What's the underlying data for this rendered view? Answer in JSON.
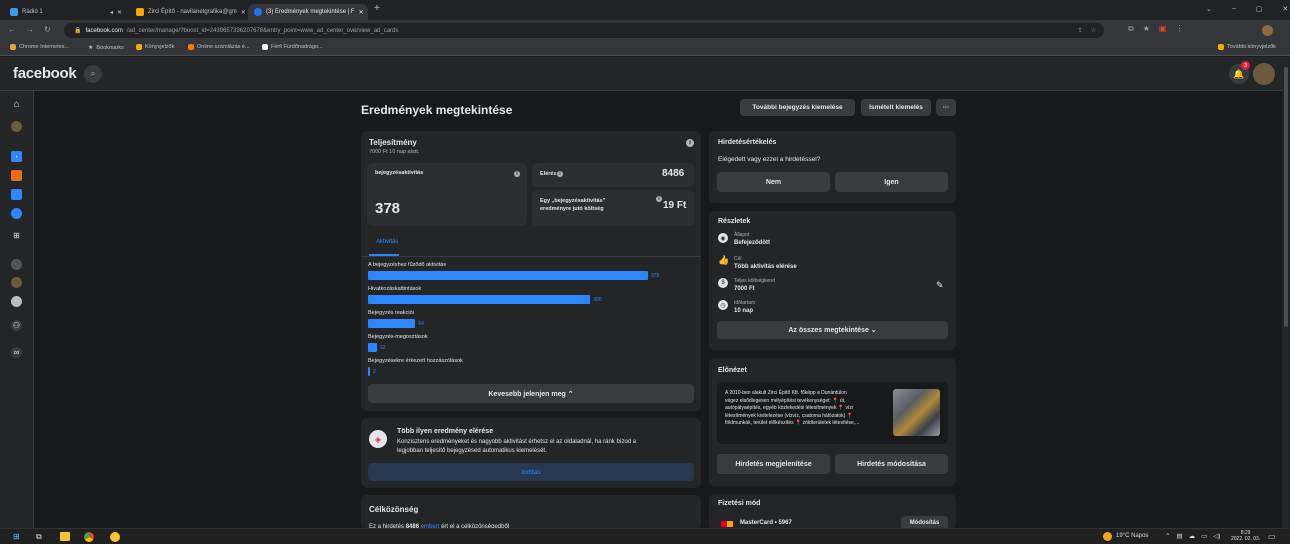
{
  "browser": {
    "tabs": [
      {
        "title": "Rádió 1",
        "color": "#3d9be9"
      },
      {
        "title": "Zirci Építő - navilanetgrafika@gm",
        "color": "#f9ab00"
      },
      {
        "title": "(3) Eredmények megtekintése | F",
        "color": "#1877f2"
      }
    ],
    "new_tab": "+",
    "window_controls": [
      "⌄",
      "–",
      "▢",
      "✕"
    ],
    "url_host": "facebook.com",
    "url_path": "/ad_center/manage/?boost_id=2439657336207678&entry_point=www_ad_center_overview_ad_cards",
    "bookmarks": [
      "Chrome Internetes...",
      "Bookmarks",
      "Könyvjelzők",
      "Online számlázás é...",
      "Férfi Fürdőnadrágo..."
    ],
    "other_bookmarks": "További könyvjelzők"
  },
  "fb": {
    "logo": "facebook",
    "notif_count": "3",
    "page_title": "Eredmények megtekintése",
    "actions": [
      "További bejegyzés kiemelése",
      "Ismételt kiemelés",
      "···"
    ]
  },
  "performance": {
    "title": "Teljesítmény",
    "subtitle": "7000 Ft 10 nap alatt.",
    "activity_label": "bejegyzésaktivitás",
    "activity_value": "378",
    "reach_label": "Elérés",
    "reach_value": "8486",
    "cost_label_1": "Egy „bejegyzésaktivitás\"",
    "cost_label_2": "eredményre jutó költség",
    "cost_value": "19 Ft",
    "tab": "Aktivitás"
  },
  "chart_data": {
    "type": "bar",
    "orientation": "horizontal",
    "categories": [
      "A bejegyzéshez fűződő aktivitás",
      "Hivatkozáskattintások",
      "Bejegyzés reakciói",
      "Bejegyzés-megosztások",
      "Bejegyzésekre érkezett hozzászólások"
    ],
    "values": [
      378,
      300,
      64,
      12,
      2
    ],
    "color": "#2d88ff"
  },
  "show_less": "Kevesebb jelenjen meg ⌃",
  "more_results": {
    "title": "Több ilyen eredmény elérése",
    "text_1": "Konzisztens eredményeket és nagyobb aktivitást érhetsz el az oldaladnál, ha ránk bízod a",
    "text_2": "legjobban teljesítő bejegyzésed automatikus kiemelését.",
    "button": "Indítás"
  },
  "audience": {
    "title": "Célközönség",
    "text_prefix": "Ez a hirdetés ",
    "text_num": "8486",
    "text_link": "embert",
    "text_suffix": " ért el a célközönségedből"
  },
  "rating": {
    "title": "Hirdetésértékelés",
    "question": "Elégedett vagy ezzel a hirdetéssel?",
    "no": "Nem",
    "yes": "Igen"
  },
  "details": {
    "title": "Részletek",
    "rows": [
      {
        "label": "Állapot",
        "value": "Befejeződött",
        "icon": "status-icon"
      },
      {
        "label": "Cél",
        "value": "Több aktivitás elérése",
        "icon": "thumbs-up-icon"
      },
      {
        "label": "Teljes költségkeret",
        "value": "7000 Ft",
        "icon": "money-icon"
      },
      {
        "label": "Időtartam",
        "value": "10 nap",
        "icon": "clock-icon"
      }
    ],
    "see_all": "Az összes megtekintése ⌄"
  },
  "preview": {
    "title": "Előnézet",
    "lines": [
      "A 2010-ben alakult Zirci Építő Kft. főképp a Dunántúlon",
      "végez elsődlegesen mélyépítési tevékenységet: 📍 út,",
      "autópályaépítés, egyéb közlekedési létesítmények 📍 vízi",
      "létesítmények kivitelezése (vízvíz, csatorna hálózatok) 📍",
      "földmunkák, terület előkészítés 📍 zöldterületek létesítése,..."
    ],
    "show_ad": "Hirdetés megjelenítése",
    "edit_ad": "Hirdetés módosítása"
  },
  "payment": {
    "title": "Fizetési mód",
    "card": "MasterCard • 5967",
    "edit": "Módosítás"
  },
  "taskbar": {
    "weather": "19°C Napos",
    "time": "8:29",
    "date": "2022. 02. 03."
  }
}
